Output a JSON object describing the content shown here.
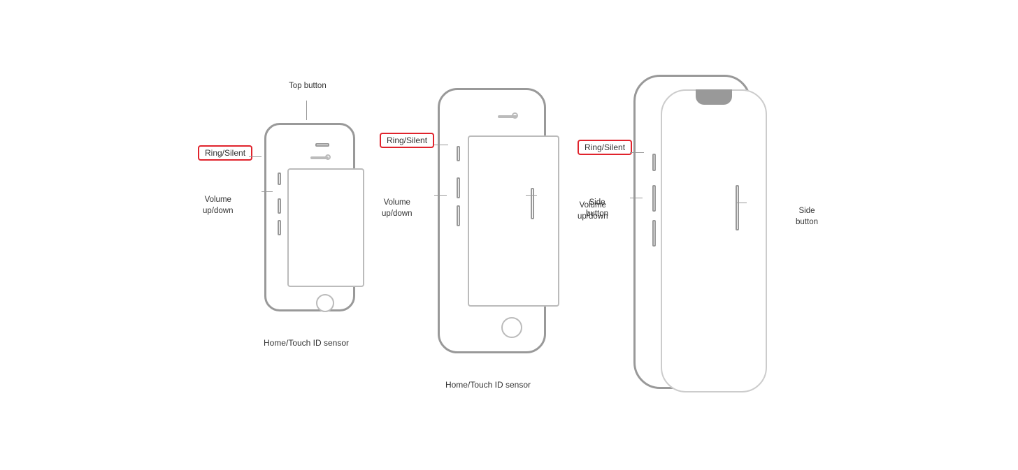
{
  "phones": [
    {
      "id": "se",
      "labels": {
        "top_button": "Top button",
        "ring_silent": "Ring/Silent",
        "volume": "Volume\nup/down",
        "home": "Home/Touch ID sensor"
      }
    },
    {
      "id": "med",
      "labels": {
        "ring_silent": "Ring/Silent",
        "volume": "Volume\nup/down",
        "side_button": "Side\nbutton",
        "home": "Home/Touch ID sensor"
      }
    },
    {
      "id": "large",
      "labels": {
        "ring_silent": "Ring/Silent",
        "volume": "Volume\nup/down",
        "side_button": "Side\nbutton"
      }
    }
  ]
}
